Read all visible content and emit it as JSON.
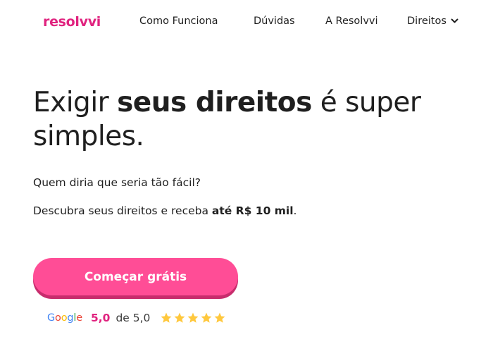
{
  "header": {
    "logo_text": "resolvvi",
    "nav": {
      "como_funciona": "Como Funciona",
      "duvidas": "Dúvidas",
      "a_resolvvi": "A Resolvvi",
      "direitos": "Direitos"
    }
  },
  "hero": {
    "headline_part1": "Exigir ",
    "headline_bold": "seus direitos",
    "headline_part2": " é super simples.",
    "line1": "Quem diria que seria tão fácil?",
    "line2_prefix": "Descubra seus direitos e receba ",
    "line2_bold": "até R$ 10 mil",
    "line2_suffix": "."
  },
  "cta": {
    "label": "Começar grátis"
  },
  "rating": {
    "provider": "Google",
    "score": "5,0",
    "of_text": "de 5,0",
    "stars": 5,
    "star_color": "#FFC83D"
  },
  "colors": {
    "brand_pink": "#e0237f",
    "button_pink": "#ff4d96",
    "button_shadow": "#c72d6d"
  }
}
